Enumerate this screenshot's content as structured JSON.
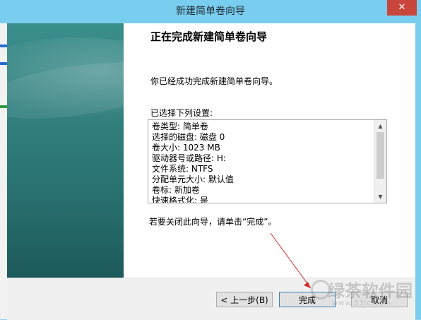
{
  "window": {
    "title": "新建简单卷向导",
    "close_glyph": "✕"
  },
  "heading": "正在完成新建简单卷向导",
  "intro": "你已经成功完成新建简单卷向导。",
  "settings_label": "已选择下列设置:",
  "settings": [
    "卷类型: 简单卷",
    "选择的磁盘: 磁盘 0",
    "卷大小: 1023 MB",
    "驱动器号或路径: H:",
    "文件系统: NTFS",
    "分配单元大小: 默认值",
    "卷标: 新加卷",
    "快速格式化: 是"
  ],
  "finish_note": "若要关闭此向导，请单击“完成”。",
  "buttons": {
    "back": "< 上一步(B)",
    "finish": "完成",
    "cancel": "取消"
  },
  "watermark": {
    "text": "绿茶软件园",
    "url": "www.33lc.com"
  },
  "colors": {
    "titlebar": "#79cdef",
    "close": "#c9463d",
    "panel": "#2d7877",
    "annotation_arrow": "#d42a2a"
  }
}
